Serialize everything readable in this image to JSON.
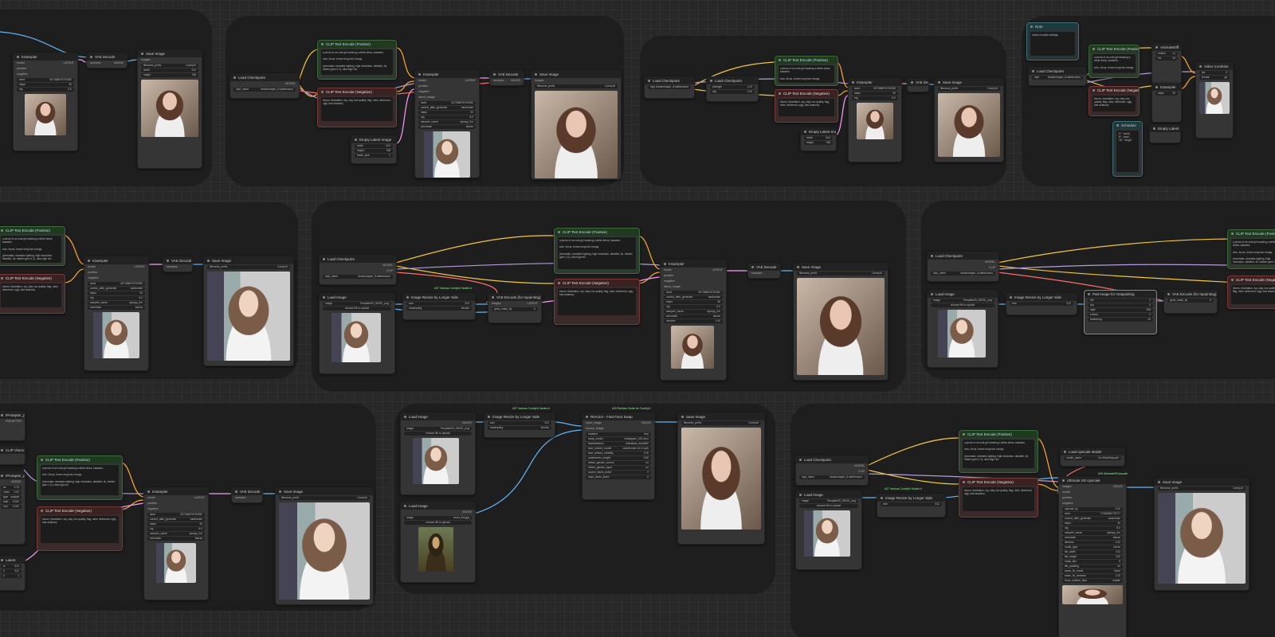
{
  "app": {
    "name": "ComfyUI workflow canvas"
  },
  "colors": {
    "clip": "#f3c63f",
    "model": "#b39ddb",
    "vae": "#ff6e6e",
    "latent": "#ff9cf9",
    "image": "#64b5f6",
    "conditioning": "#ffa931"
  },
  "nodes": {
    "ksampler": "KSampler",
    "vae_decode": "VAE Decode",
    "vae_encode": "VAE Encode",
    "save_image": "Save Image",
    "load_checkpoint": "Load Checkpoint",
    "clip_pos": "CLIP Text Encode (Positive)",
    "clip_neg": "CLIP Text Encode (Negative)",
    "empty_latent": "Empty Latent Image",
    "load_image": "Load Image",
    "resize_longer": "Image Resize by Longer Side",
    "vae_inpaint": "VAE Encode (for Inpainting)",
    "pad_outpaint": "Pad Image for Outpainting",
    "face_swap": "ReActor - Fast Face Swap",
    "ultimate_upscale": "Ultimate SD Upscale",
    "load_upscale": "Load Upscale Model",
    "video_combine": "Video Combine 🎥"
  },
  "ports": {
    "model": "model",
    "positive": "positive",
    "negative": "negative",
    "latent_image": "latent_image",
    "samples": "samples",
    "vae": "vae",
    "images": "images",
    "clip": "clip",
    "model_out": "MODEL",
    "clip_out": "CLIP",
    "vae_out": "VAE",
    "latent_out": "LATENT",
    "image_out": "IMAGE",
    "mask_out": "MASK",
    "cond_out": "CONDITIONING"
  },
  "ksampler_widgets": [
    {
      "k": "seed",
      "v": "827368575767650"
    },
    {
      "k": "control_after_generate",
      "v": "randomize"
    },
    {
      "k": "steps",
      "v": "30"
    },
    {
      "k": "cfg",
      "v": "6.0"
    },
    {
      "k": "sampler_name",
      "v": "dpmpp_2m"
    },
    {
      "k": "scheduler",
      "v": "karras"
    },
    {
      "k": "denoise",
      "v": "1.00"
    }
  ],
  "texts": {
    "pos_prompt": "a photo of an cute girl wearing a white dress, kawaiee,\n\nsolo, focus, brown long hair, bangs,\n\n(cinematic, dramatic lighting, high resolution, detailed, 4k, hidden gem:1.2), ultra high res",
    "neg_prompt": "bloom, illustration, toy, clay, low quality, flag, nsfw, deformed, ugly, bad anatomy",
    "ckpt": "dreamshaper_8.safetensors",
    "choose_file": "choose file to upload",
    "img_file": "Template00_00005_.png",
    "mona_file": "mona_lisa.jpg",
    "save_prefix": "ComfyUI",
    "width": "512",
    "height": "768",
    "batch": "1",
    "video_header": "Video Combine",
    "upscale_model": "4x-UltraSharp.pth",
    "group_note": "#37 Various ComfyUI Nodes b",
    "group_note2": "#33 ReActor Node for ComfyUI",
    "group_note3": "#26 UltimateSDUpscale"
  },
  "face_swap_widgets": [
    {
      "k": "enabled",
      "v": "true"
    },
    {
      "k": "swap_model",
      "v": "inswapper_128.onnx"
    },
    {
      "k": "facedetection",
      "v": "retinaface_resnet50"
    },
    {
      "k": "face_restore_model",
      "v": "codeformer-v0.1.0.pth"
    },
    {
      "k": "face_restore_visibility",
      "v": "1.00"
    },
    {
      "k": "codeformer_weight",
      "v": "0.50"
    },
    {
      "k": "detect_gender_source",
      "v": "no"
    },
    {
      "k": "detect_gender_input",
      "v": "no"
    },
    {
      "k": "source_faces_index",
      "v": "0"
    },
    {
      "k": "input_faces_index",
      "v": "0"
    }
  ],
  "upscale_widgets": [
    {
      "k": "upscale_by",
      "v": "2.00"
    },
    {
      "k": "seed",
      "v": "77306368775777"
    },
    {
      "k": "control_after_generate",
      "v": "randomize"
    },
    {
      "k": "steps",
      "v": "20"
    },
    {
      "k": "cfg",
      "v": "8.0"
    },
    {
      "k": "sampler_name",
      "v": "dpmpp_2m"
    },
    {
      "k": "scheduler",
      "v": "karras"
    },
    {
      "k": "denoise",
      "v": "0.20"
    },
    {
      "k": "mode_type",
      "v": "Linear"
    },
    {
      "k": "tile_width",
      "v": "512"
    },
    {
      "k": "tile_height",
      "v": "512"
    },
    {
      "k": "mask_blur",
      "v": "8"
    },
    {
      "k": "tile_padding",
      "v": "32"
    },
    {
      "k": "seam_fix_mode",
      "v": "None"
    },
    {
      "k": "seam_fix_denoise",
      "v": "1.00"
    },
    {
      "k": "force_uniform_tiles",
      "v": "enable"
    }
  ],
  "pad_widgets": [
    {
      "k": "left",
      "v": "0"
    },
    {
      "k": "top",
      "v": "0"
    },
    {
      "k": "right",
      "v": "256"
    },
    {
      "k": "bottom",
      "v": "0"
    },
    {
      "k": "feathering",
      "v": "40"
    }
  ]
}
